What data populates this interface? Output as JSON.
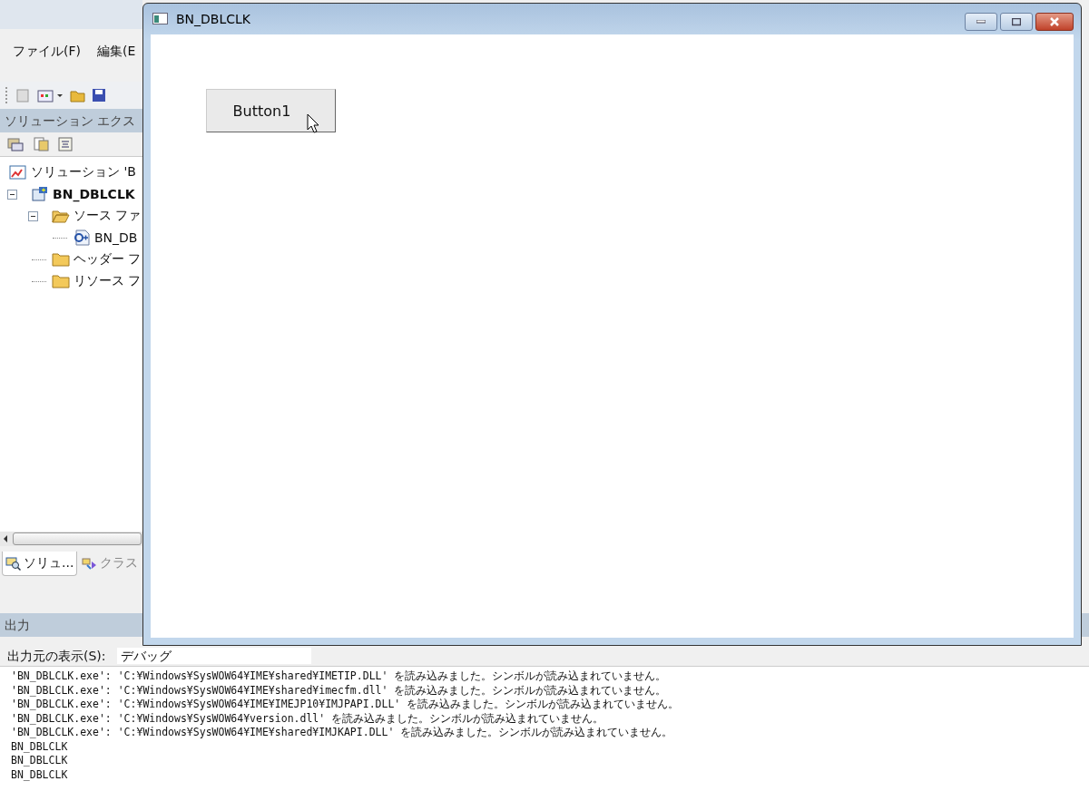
{
  "ide": {
    "menu": [
      "ファイル(F)",
      "編集(E"
    ],
    "solution_explorer": {
      "title": "ソリューション エクス",
      "tree": [
        {
          "kind": "solution",
          "label": "ソリューション 'B",
          "children": [
            {
              "kind": "project",
              "label": "BN_DBLCLK",
              "expanded": true,
              "children": [
                {
                  "kind": "folder",
                  "label": "ソース ファ",
                  "expanded": true,
                  "children": [
                    {
                      "kind": "file",
                      "label": "BN_DB"
                    }
                  ]
                },
                {
                  "kind": "folder",
                  "label": "ヘッダー フ"
                },
                {
                  "kind": "folder",
                  "label": "リソース フ"
                }
              ]
            }
          ]
        }
      ]
    },
    "tabs": [
      {
        "label": "ソリュ...",
        "selected": true
      },
      {
        "label": "クラス",
        "selected": false
      }
    ]
  },
  "output": {
    "title": "出力",
    "source_label": "出力元の表示(S):",
    "source_value": "デバッグ",
    "lines": [
      "'BN_DBLCLK.exe': 'C:¥Windows¥SysWOW64¥IME¥shared¥IMETIP.DLL' を読み込みました。シンボルが読み込まれていません。",
      "'BN_DBLCLK.exe': 'C:¥Windows¥SysWOW64¥IME¥shared¥imecfm.dll' を読み込みました。シンボルが読み込まれていません。",
      "'BN_DBLCLK.exe': 'C:¥Windows¥SysWOW64¥IME¥IMEJP10¥IMJPAPI.DLL' を読み込みました。シンボルが読み込まれていません。",
      "'BN_DBLCLK.exe': 'C:¥Windows¥SysWOW64¥version.dll' を読み込みました。シンボルが読み込まれていません。",
      "'BN_DBLCLK.exe': 'C:¥Windows¥SysWOW64¥IME¥shared¥IMJKAPI.DLL' を読み込みました。シンボルが読み込まれていません。",
      "BN_DBLCLK",
      "BN_DBLCLK",
      "BN_DBLCLK"
    ]
  },
  "window": {
    "title": "BN_DBLCLK",
    "button": {
      "label": "Button1"
    }
  }
}
